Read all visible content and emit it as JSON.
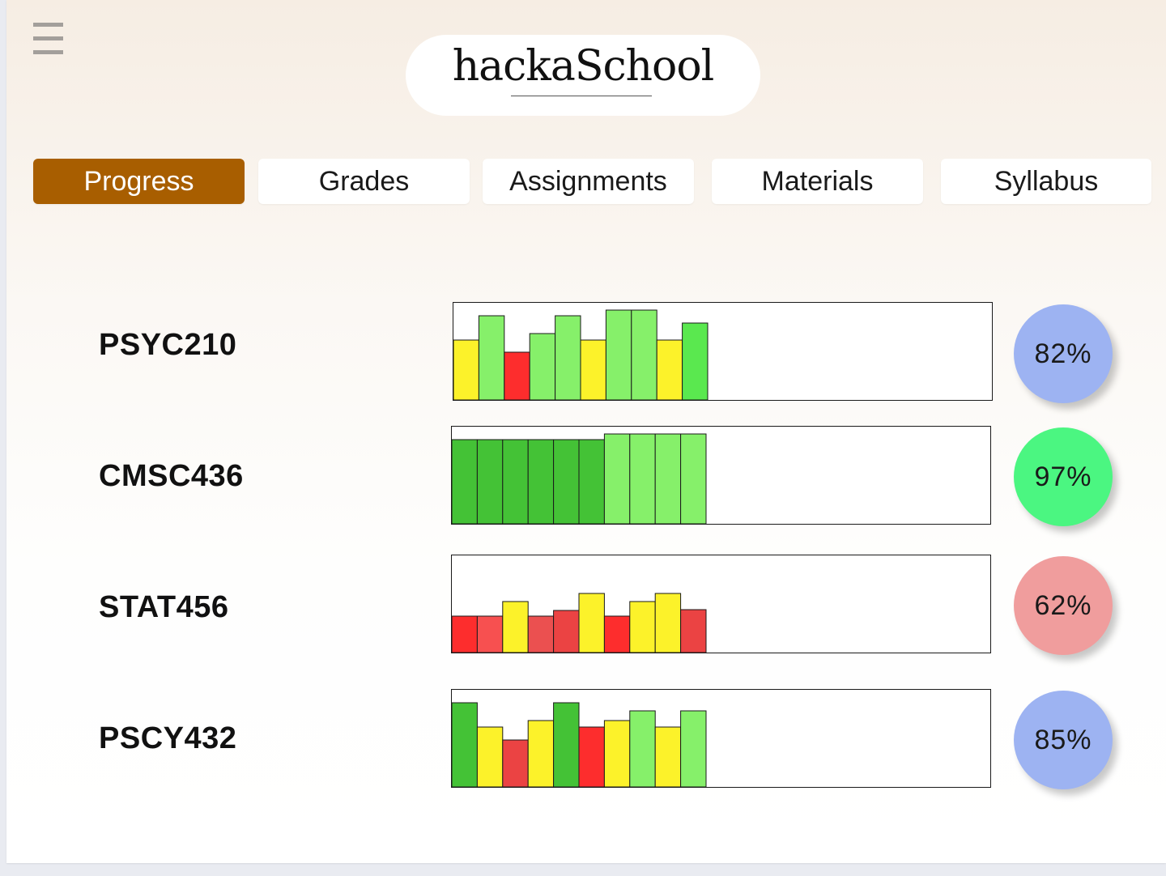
{
  "app": {
    "logo": "hackaSchool",
    "menu_icon": "hamburger-menu-icon"
  },
  "tabs": [
    {
      "label": "Progress",
      "active": true
    },
    {
      "label": "Grades",
      "active": false
    },
    {
      "label": "Assignments",
      "active": false
    },
    {
      "label": "Materials",
      "active": false
    },
    {
      "label": "Syllabus",
      "active": false
    }
  ],
  "colors": {
    "active_tab": "#a85e00",
    "dark_green": "#44c236",
    "light_green": "#86f06a",
    "bright_green": "#5ae84f",
    "yellow": "#fcf22a",
    "red": "#fd2d2d",
    "light_red": "#f75050",
    "mid_red": "#eb4343",
    "circle_blue": "#9db3f2",
    "circle_green": "#4bf681",
    "circle_red": "#f09d9d"
  },
  "courses": [
    {
      "name": "PSYC210",
      "percent": "82%",
      "circle_color": "#9db3f2",
      "chart_data": {
        "type": "bar",
        "values": [
          74,
          104,
          59,
          82,
          104,
          74,
          111,
          111,
          74,
          95
        ],
        "colors": [
          "#fcf22a",
          "#86f06a",
          "#fd2d2d",
          "#86f06a",
          "#86f06a",
          "#fcf22a",
          "#86f06a",
          "#86f06a",
          "#fcf22a",
          "#5ae84f"
        ],
        "ylim": [
          0,
          120
        ]
      }
    },
    {
      "name": "CMSC436",
      "percent": "97%",
      "circle_color": "#4bf681",
      "chart_data": {
        "type": "bar",
        "values": [
          104,
          104,
          104,
          104,
          104,
          104,
          111,
          111,
          111,
          111
        ],
        "colors": [
          "#44c236",
          "#44c236",
          "#44c236",
          "#44c236",
          "#44c236",
          "#44c236",
          "#86f06a",
          "#86f06a",
          "#86f06a",
          "#86f06a"
        ],
        "ylim": [
          0,
          120
        ]
      }
    },
    {
      "name": "STAT456",
      "percent": "62%",
      "circle_color": "#f09d9d",
      "chart_data": {
        "type": "bar",
        "values": [
          45,
          45,
          63,
          45,
          52,
          73,
          45,
          63,
          73,
          53
        ],
        "colors": [
          "#fd2d2d",
          "#f75050",
          "#fcf22a",
          "#eb5050",
          "#eb4343",
          "#fcf22a",
          "#fd2d2d",
          "#fcf22a",
          "#fcf22a",
          "#eb4343"
        ],
        "ylim": [
          0,
          120
        ]
      }
    },
    {
      "name": "PSCY432",
      "percent": "85%",
      "circle_color": "#9db3f2",
      "chart_data": {
        "type": "bar",
        "values": [
          104,
          74,
          58,
          82,
          104,
          74,
          82,
          94,
          74,
          94
        ],
        "colors": [
          "#44c236",
          "#fcf22a",
          "#eb4343",
          "#fcf22a",
          "#44c236",
          "#fd2d2d",
          "#fcf22a",
          "#86f06a",
          "#fcf22a",
          "#86f06a"
        ],
        "ylim": [
          0,
          120
        ]
      }
    }
  ]
}
